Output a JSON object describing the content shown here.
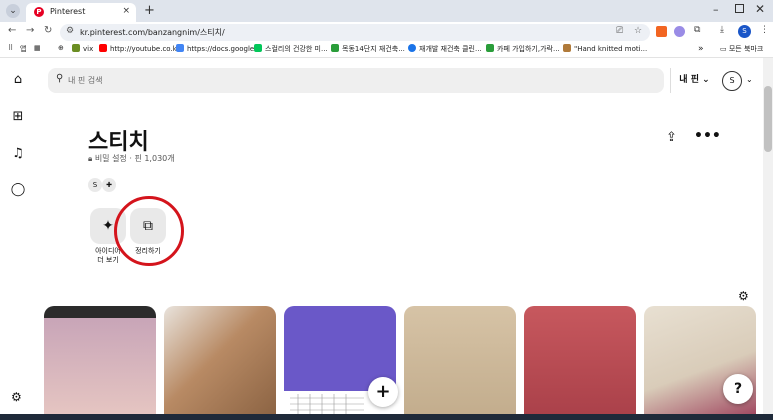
{
  "browser": {
    "tab_title": "Pinterest",
    "tab_favicon": "P",
    "tab_close": "×",
    "new_tab": "+",
    "url": "kr.pinterest.com/banzangnim/스티치/",
    "profile_initial": "S"
  },
  "bookmarks": [
    {
      "label": "앱",
      "color": "#5f6368"
    },
    {
      "label": "vix",
      "color": "#6b8e23"
    },
    {
      "label": "http://youtube.co.kr/",
      "color": "#ff0000"
    },
    {
      "label": "https://docs.google...",
      "color": "#4285f4"
    },
    {
      "label": "스컬리의 건강한 미...",
      "color": "#03c75a"
    },
    {
      "label": "목동14단지 재건축...",
      "color": "#2a9d3a"
    },
    {
      "label": "재개발 재건축 클린...",
      "color": "#1a73e8"
    },
    {
      "label": "카페 가입하기,가락...",
      "color": "#2a9d3a"
    },
    {
      "label": "\"Hand knitted moti...",
      "color": "#b07a3a"
    }
  ],
  "bookmarks_more": "»",
  "bookmarks_folder": "모든 북마크",
  "search": {
    "placeholder": "내 핀 검색"
  },
  "header": {
    "my_pins": "내 핀",
    "avatar": "S"
  },
  "board": {
    "title": "스티치",
    "privacy": "비밀 설정",
    "separator": "·",
    "pin_count": "핀 1,030개",
    "collaborator": "S"
  },
  "actions": {
    "ideas_label_1": "아이디어",
    "ideas_label_2": "더 보기",
    "organize_label": "정리하기"
  },
  "icons": {
    "home": "home-icon",
    "create": "create-icon",
    "notifications": "bell-icon",
    "messages": "chat-icon",
    "settings": "gear-icon",
    "share": "share-icon",
    "more": "more-icon",
    "filter": "filter-icon",
    "help": "help-icon"
  },
  "pins": [
    {
      "color_top": "#c8a5b8",
      "color_bottom": "#e7c7c2"
    },
    {
      "color_top": "#b88a64",
      "color_bottom": "#8a6242"
    },
    {
      "color_top": "#6a58c8",
      "color_bottom": "#ffffff"
    },
    {
      "color_top": "#d6c3a6",
      "color_bottom": "#c2ac8c"
    },
    {
      "color_top": "#c7585e",
      "color_bottom": "#a94049"
    },
    {
      "color_top": "#e8e0d2",
      "color_bottom": "#9c3e5a"
    }
  ],
  "colors": {
    "brand": "#e60023",
    "highlight_circle": "#d4141c"
  }
}
